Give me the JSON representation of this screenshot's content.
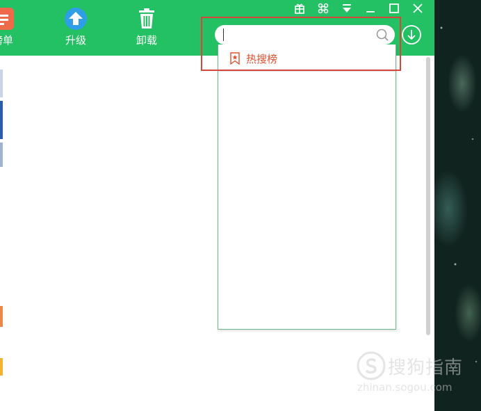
{
  "toolbar": {
    "rank_label": "榜单",
    "upgrade_label": "升级",
    "uninstall_label": "卸载"
  },
  "search": {
    "value": "",
    "placeholder": ""
  },
  "dropdown": {
    "items": [
      {
        "label": "热搜榜",
        "icon": "bookmark-star-icon"
      }
    ]
  },
  "watermark": {
    "name": "搜狗指南",
    "url": "zhinan.sogou.com"
  },
  "colors": {
    "brand_green": "#23c064",
    "rank_orange": "#ef6a4a",
    "upgrade_blue": "#2e9ee8",
    "hot_red": "#e0522f",
    "highlight_red": "#d9443a"
  }
}
